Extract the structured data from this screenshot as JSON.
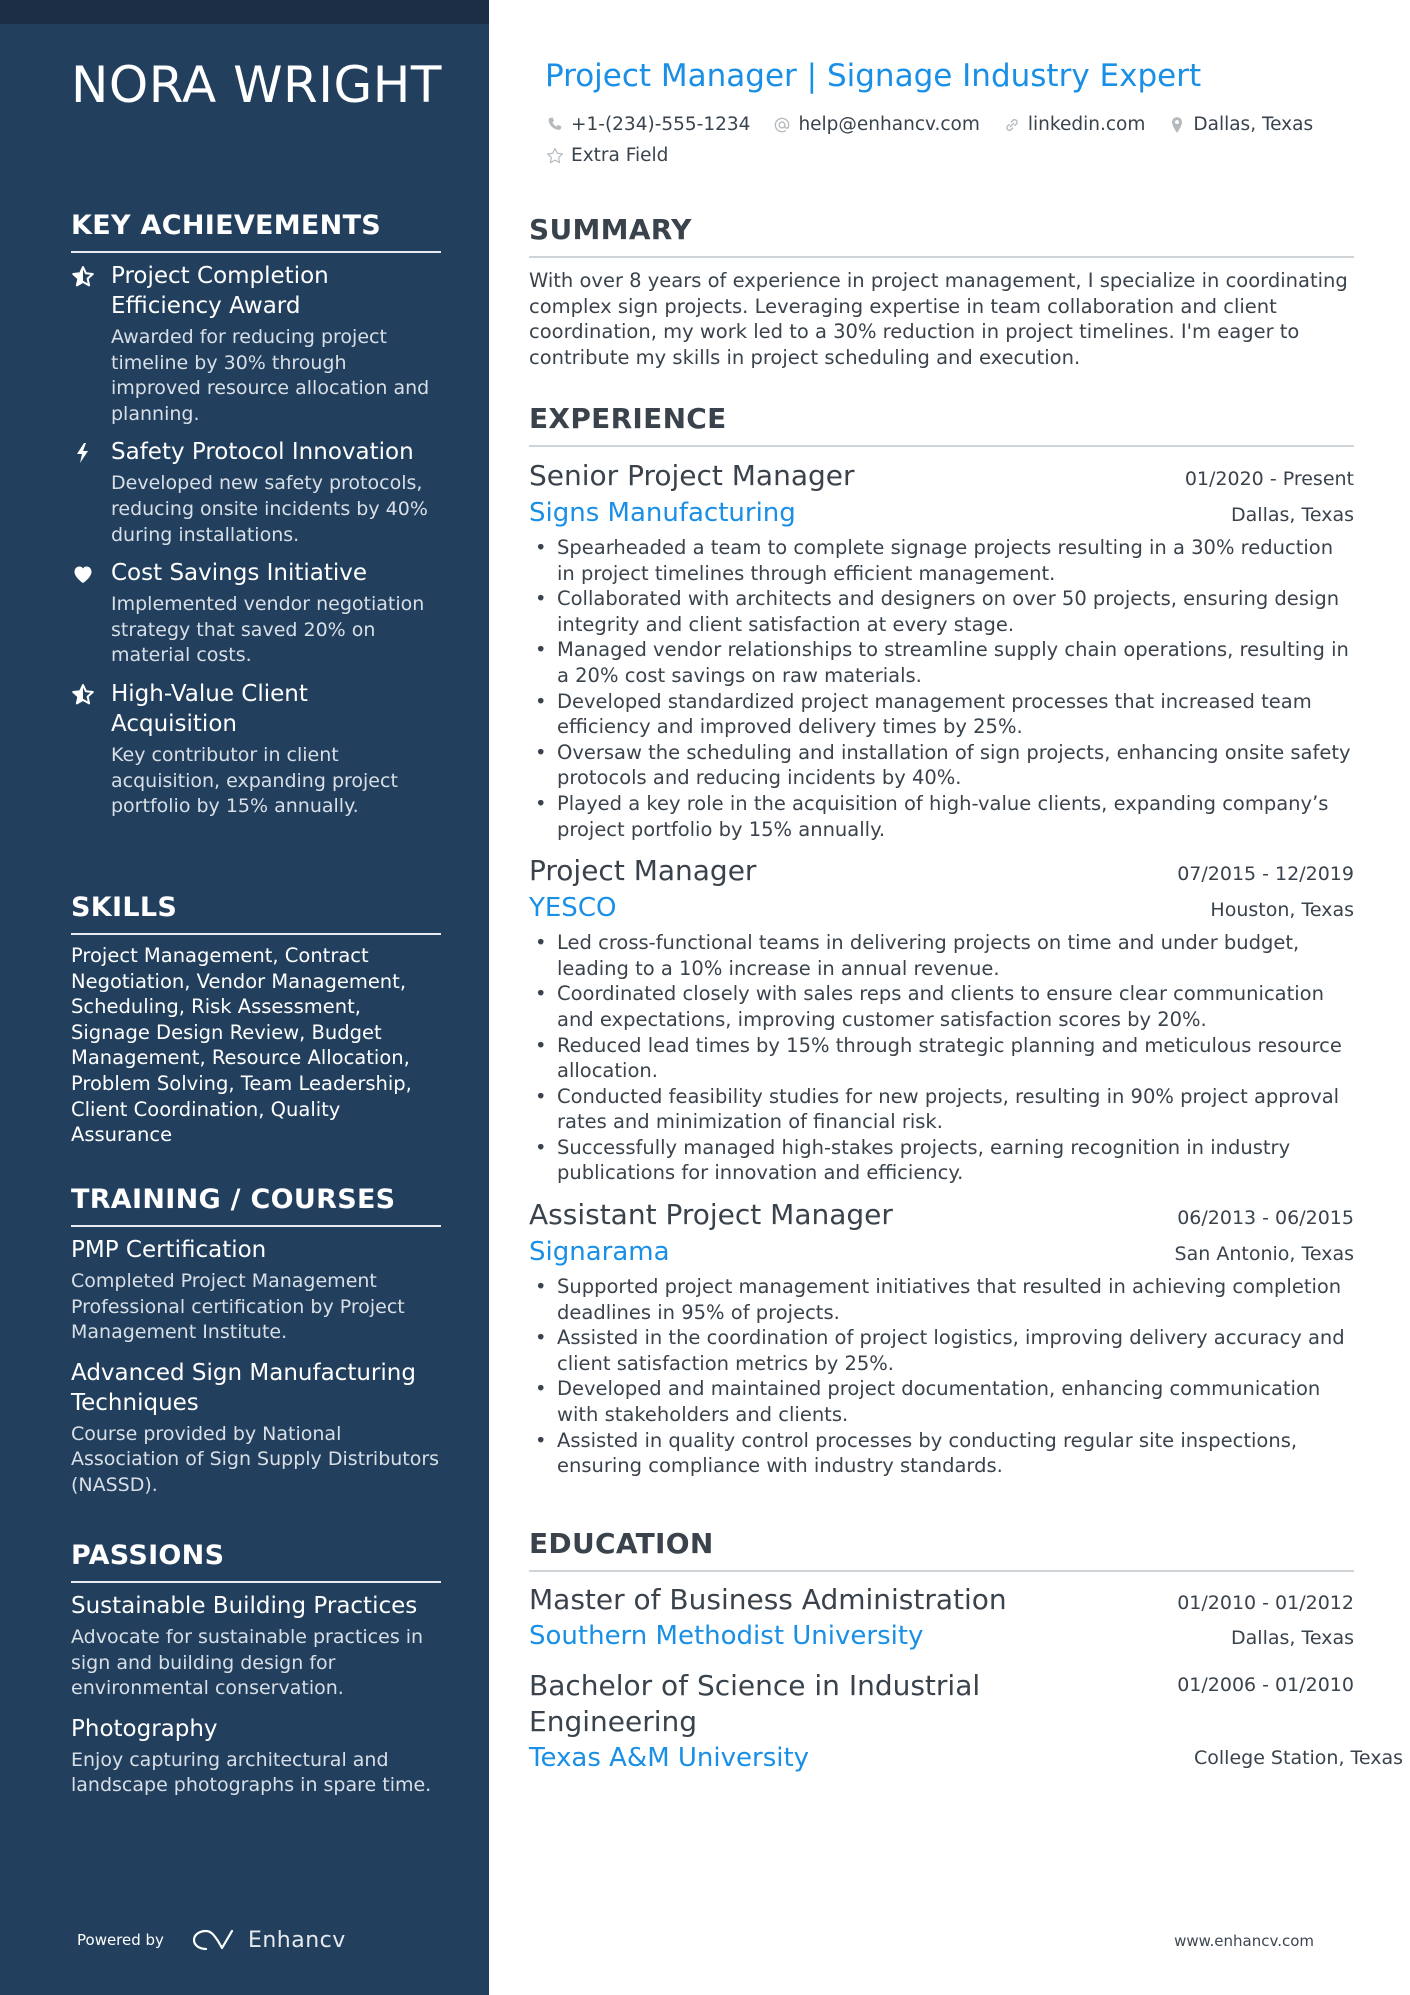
{
  "colors": {
    "sidebar_bg": "#22405e",
    "sidebar_top_strip": "#1b2e45",
    "accent": "#1a8fe6",
    "text": "#3a434c"
  },
  "name": "NORA WRIGHT",
  "title": "Project Manager | Signage Industry Expert",
  "contacts": {
    "phone": {
      "icon": "phone-icon",
      "value": "+1-(234)-555-1234"
    },
    "email": {
      "icon": "at-icon",
      "value": "help@enhancv.com"
    },
    "linkedin": {
      "icon": "link-icon",
      "value": "linkedin.com"
    },
    "location": {
      "icon": "location-pin-icon",
      "value": "Dallas, Texas"
    },
    "extra": {
      "icon": "star-outline-icon",
      "value": "Extra Field"
    }
  },
  "sidebar": {
    "achievements": {
      "heading": "KEY ACHIEVEMENTS",
      "items": [
        {
          "icon": "star-half-icon",
          "title": "Project Completion Efficiency Award",
          "desc": "Awarded for reducing project timeline by 30% through improved resource allocation and planning."
        },
        {
          "icon": "lightning-bolt-icon",
          "title": "Safety Protocol Innovation",
          "desc": "Developed new safety protocols, reducing onsite incidents by 40% during installations."
        },
        {
          "icon": "heart-icon",
          "title": "Cost Savings Initiative",
          "desc": "Implemented vendor negotiation strategy that saved 20% on material costs."
        },
        {
          "icon": "star-half-icon",
          "title": "High-Value Client Acquisition",
          "desc": "Key contributor in client acquisition, expanding project portfolio by 15% annually."
        }
      ]
    },
    "skills": {
      "heading": "SKILLS",
      "text": "Project Management, Contract Negotiation, Vendor Management, Scheduling, Risk Assessment, Signage Design Review, Budget Management, Resource Allocation, Problem Solving, Team Leadership, Client Coordination, Quality Assurance"
    },
    "training": {
      "heading": "TRAINING / COURSES",
      "items": [
        {
          "title": "PMP Certification",
          "desc": "Completed Project Management Professional certification by Project Management Institute."
        },
        {
          "title": "Advanced Sign Manufacturing Techniques",
          "desc": "Course provided by National Association of Sign Supply Distributors (NASSD)."
        }
      ]
    },
    "passions": {
      "heading": "PASSIONS",
      "items": [
        {
          "title": "Sustainable Building Practices",
          "desc": "Advocate for sustainable practices in sign and building design for environmental conservation."
        },
        {
          "title": "Photography",
          "desc": "Enjoy capturing architectural and landscape photographs in spare time."
        }
      ]
    }
  },
  "summary": {
    "heading": "SUMMARY",
    "text": "With over 8 years of experience in project management, I specialize in coordinating complex sign projects. Leveraging expertise in team collaboration and client coordination, my work led to a 30% reduction in project timelines. I'm eager to contribute my skills in project scheduling and execution."
  },
  "experience": {
    "heading": "EXPERIENCE",
    "jobs": [
      {
        "title": "Senior Project Manager",
        "dates": "01/2020 - Present",
        "company": "Signs Manufacturing",
        "location": "Dallas, Texas",
        "bullets": [
          "Spearheaded a team to complete signage projects resulting in a 30% reduction in project timelines through efficient management.",
          "Collaborated with architects and designers on over 50 projects, ensuring design integrity and client satisfaction at every stage.",
          "Managed vendor relationships to streamline supply chain operations, resulting in a 20% cost savings on raw materials.",
          "Developed standardized project management processes that increased team efficiency and improved delivery times by 25%.",
          "Oversaw the scheduling and installation of sign projects, enhancing onsite safety protocols and reducing incidents by 40%.",
          "Played a key role in the acquisition of high-value clients, expanding company’s project portfolio by 15% annually."
        ]
      },
      {
        "title": "Project Manager",
        "dates": "07/2015 - 12/2019",
        "company": "YESCO",
        "location": "Houston, Texas",
        "bullets": [
          "Led cross-functional teams in delivering projects on time and under budget, leading to a 10% increase in annual revenue.",
          "Coordinated closely with sales reps and clients to ensure clear communication and expectations, improving customer satisfaction scores by 20%.",
          "Reduced lead times by 15% through strategic planning and meticulous resource allocation.",
          "Conducted feasibility studies for new projects, resulting in 90% project approval rates and minimization of financial risk.",
          "Successfully managed high-stakes projects, earning recognition in industry publications for innovation and efficiency."
        ]
      },
      {
        "title": "Assistant Project Manager",
        "dates": "06/2013 - 06/2015",
        "company": "Signarama",
        "location": "San Antonio, Texas",
        "bullets": [
          "Supported project management initiatives that resulted in achieving completion deadlines in 95% of projects.",
          "Assisted in the coordination of project logistics, improving delivery accuracy and client satisfaction metrics by 25%.",
          "Developed and maintained project documentation, enhancing communication with stakeholders and clients.",
          "Assisted in quality control processes by conducting regular site inspections, ensuring compliance with industry standards."
        ]
      }
    ]
  },
  "education": {
    "heading": "EDUCATION",
    "items": [
      {
        "degree": "Master of Business Administration",
        "dates": "01/2010 - 01/2012",
        "school": "Southern Methodist University",
        "location": "Dallas, Texas"
      },
      {
        "degree": "Bachelor of Science in Industrial Engineering",
        "dates": "01/2006 - 01/2010",
        "school": "Texas A&M University",
        "location": "College Station, Texas"
      }
    ]
  },
  "footer": {
    "powered_by": "Powered by",
    "brand": "Enhancv",
    "website": "www.enhancv.com"
  }
}
